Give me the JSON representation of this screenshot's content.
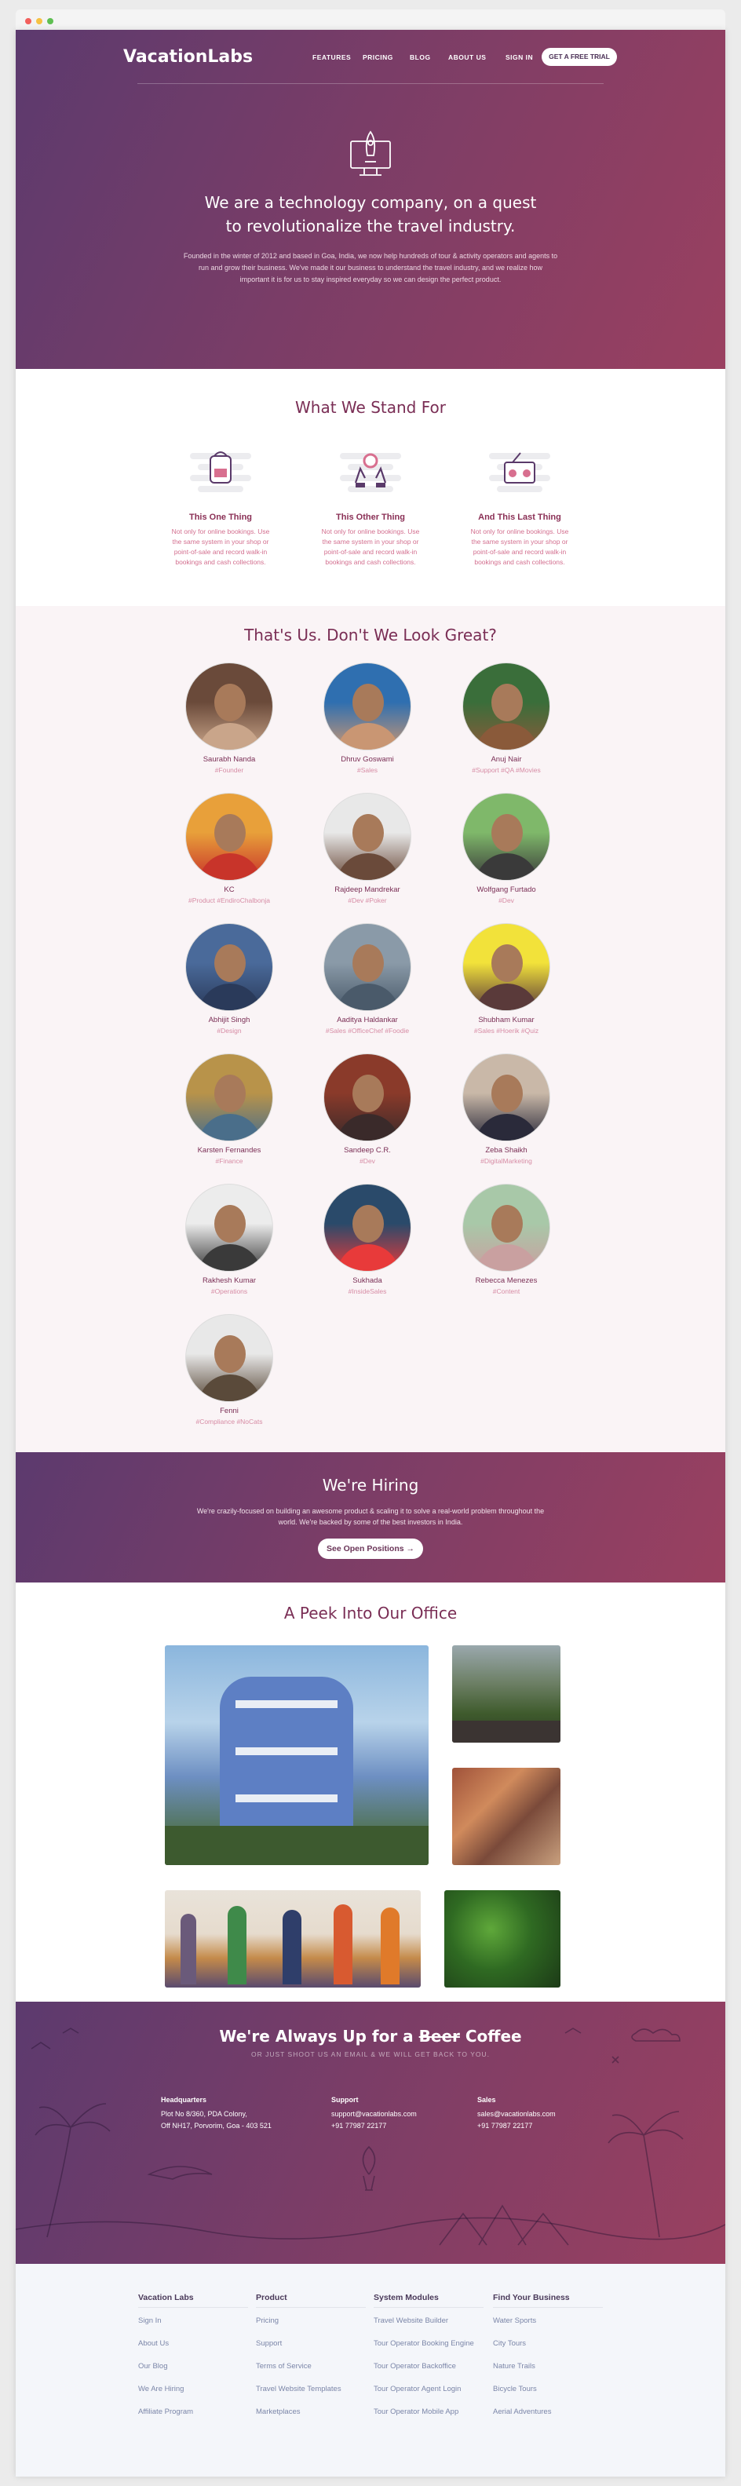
{
  "header": {
    "logo": "VacationLabs",
    "nav": [
      "FEATURES",
      "PRICING",
      "BLOG",
      "ABOUT US",
      "SIGN IN"
    ],
    "cta": "GET A FREE TRIAL",
    "icon": "rocket-monitor-icon"
  },
  "hero": {
    "title_line1": "We are a technology company, on a quest",
    "title_line2": "to revolutionalize the travel industry.",
    "body_line1": "Founded in the winter of 2012 and based in Goa, India, we now help hundreds of tour & activity operators and agents to",
    "body_line2": "run and grow their business. We've made it our business to understand the travel industry, and we realize how",
    "body_line3": "important it is for us to stay inspired everyday so we can design the perfect product."
  },
  "values": {
    "title": "What We Stand For",
    "items": [
      {
        "title": "This One Thing",
        "line1": "Not only for online bookings. Use",
        "line2": "the same system in your shop or",
        "line3": "point-of-sale and record walk-in",
        "line4": "bookings and cash collections.",
        "icon": "backpack-icon"
      },
      {
        "title": "This Other Thing",
        "line1": "Not only for online bookings. Use",
        "line2": "the same system in your shop or",
        "line3": "point-of-sale and record walk-in",
        "line4": "bookings and cash collections.",
        "icon": "hands-gear-icon"
      },
      {
        "title": "And This Last Thing",
        "line1": "Not only for online bookings. Use",
        "line2": "the same system in your shop or",
        "line3": "point-of-sale and record walk-in",
        "line4": "bookings and cash collections.",
        "icon": "radio-icon"
      }
    ]
  },
  "team": {
    "title": "That's Us. Don't We Look Great?",
    "members": [
      {
        "name": "Saurabh Nanda",
        "tags": "#Founder"
      },
      {
        "name": "Dhruv Goswami",
        "tags": "#Sales"
      },
      {
        "name": "Anuj Nair",
        "tags": "#Support #QA #Movies"
      },
      {
        "name": "KC",
        "tags": "#Product #EndiroChalbonja"
      },
      {
        "name": "Rajdeep Mandrekar",
        "tags": "#Dev #Poker"
      },
      {
        "name": "Wolfgang Furtado",
        "tags": "#Dev"
      },
      {
        "name": "Abhijit Singh",
        "tags": "#Design"
      },
      {
        "name": "Aaditya Haldankar",
        "tags": "#Sales #OfficeChef #Foodie"
      },
      {
        "name": "Shubham Kumar",
        "tags": "#Sales #Hoerik #Quiz"
      },
      {
        "name": "Karsten Fernandes",
        "tags": "#Finance"
      },
      {
        "name": "Sandeep C.R.",
        "tags": "#Dev"
      },
      {
        "name": "Zeba Shaikh",
        "tags": "#DigitalMarketing"
      },
      {
        "name": "Rakhesh Kumar",
        "tags": "#Operations"
      },
      {
        "name": "Sukhada",
        "tags": "#InsideSales"
      },
      {
        "name": "Rebecca Menezes",
        "tags": "#Content"
      },
      {
        "name": "Fenni",
        "tags": "#Compliance #NoCats"
      }
    ]
  },
  "hiring": {
    "title": "We're Hiring",
    "line1": "We're crazily-focused on building an awesome product & scaling it to solve a real-world problem throughout the",
    "line2": "world. We're backed by some of the best investors in India.",
    "cta": "See Open Positions →"
  },
  "office": {
    "title": "A Peek Into Our Office"
  },
  "contact": {
    "title_pre": "We're Always Up for a ",
    "title_strike": "Beer",
    "title_post": " Coffee",
    "subtitle": "OR JUST SHOOT US AN EMAIL & WE WILL GET BACK TO YOU.",
    "hq_label": "Headquarters",
    "hq_line1": "Plot No 8/360, PDA Colony,",
    "hq_line2": "Off NH17, Porvorim, Goa - 403 521",
    "support_label": "Support",
    "support_email": "support@vacationlabs.com",
    "support_phone": "+91 77987 22177",
    "sales_label": "Sales",
    "sales_email": "sales@vacationlabs.com",
    "sales_phone": "+91 77987 22177"
  },
  "footer": {
    "columns": [
      {
        "title": "Vacation Labs",
        "links": [
          "Sign In",
          "About Us",
          "Our Blog",
          "We Are Hiring",
          "Affiliate Program"
        ]
      },
      {
        "title": "Product",
        "links": [
          "Pricing",
          "Support",
          "Terms of Service",
          "Travel Website Templates",
          "Marketplaces"
        ]
      },
      {
        "title": "System Modules",
        "links": [
          "Travel Website Builder",
          "Tour Operator Booking Engine",
          "Tour Operator Backoffice",
          "Tour Operator Agent Login",
          "Tour Operator Mobile App"
        ]
      },
      {
        "title": "Find Your Business",
        "links": [
          "Water Sports",
          "City Tours",
          "Nature Trails",
          "Bicycle Tours",
          "Aerial Adventures"
        ]
      }
    ]
  },
  "colors": {
    "gradient_start": "#5c3a6e",
    "gradient_end": "#9a4060",
    "accent": "#7a2e55",
    "tag": "#d78ca5"
  }
}
